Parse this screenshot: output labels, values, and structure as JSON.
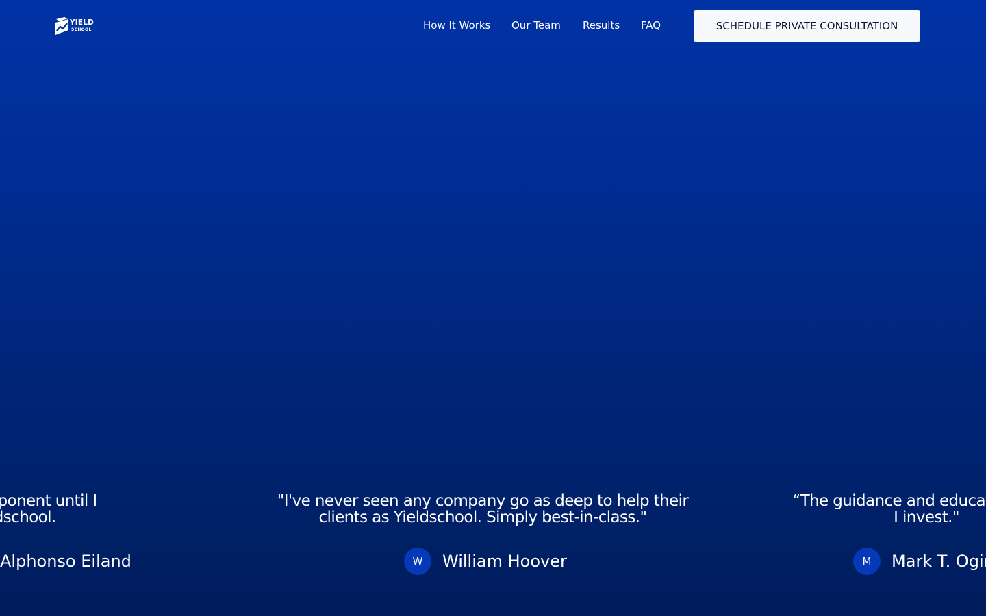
{
  "header": {
    "logo": {
      "word_top": "YIELD",
      "word_bottom": "SCHOOL"
    },
    "nav": [
      {
        "label": "How It Works"
      },
      {
        "label": "Our Team"
      },
      {
        "label": "Results"
      },
      {
        "label": "FAQ"
      }
    ],
    "cta_label": "SCHEDULE PRIVATE CONSULTATION"
  },
  "colors": {
    "background_top": "#0033a6",
    "background_bottom": "#001d5c",
    "cta_background": "#f7f9fd",
    "cta_text": "#0b1530",
    "avatar_background": "#0539b8"
  },
  "testimonials": [
    {
      "quote_line_1": "missing component until I",
      "quote_line_2": "nd Yieldschool.",
      "avatar_initial": "",
      "name": "Alphonso Eiland"
    },
    {
      "quote_line_1": "\"I've never seen any company go as deep to help their",
      "quote_line_2": "clients as Yieldschool. Simply best-in-class.\"",
      "avatar_initial": "W",
      "name": "William Hoover"
    },
    {
      "quote_line_1": "“The guidance and education comp",
      "quote_line_2": "I invest.\"",
      "avatar_initial": "M",
      "name": "Mark T. Ogin"
    }
  ]
}
